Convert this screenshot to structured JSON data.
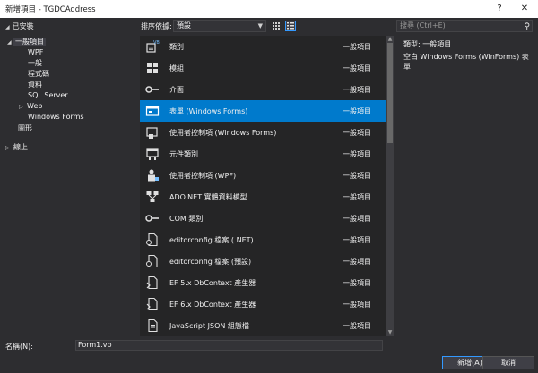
{
  "window": {
    "title": "新增項目 - TGDCAddress",
    "help_label": "?",
    "close_label": "✕"
  },
  "sidebar": {
    "header": "已安裝",
    "items": [
      {
        "label": "一般項目",
        "arrow": "◢",
        "selected": true
      },
      {
        "label": "WPF"
      },
      {
        "label": "一般"
      },
      {
        "label": "程式碼"
      },
      {
        "label": "資料"
      },
      {
        "label": "SQL Server"
      },
      {
        "label": "Web",
        "arrow": "▷"
      },
      {
        "label": "Windows Forms"
      },
      {
        "label": "圖形"
      }
    ],
    "online": {
      "label": "線上",
      "arrow": "▷"
    }
  },
  "toolbar": {
    "sort_label": "排序依據:",
    "sort_value": "預設",
    "search_placeholder": "搜尋 (Ctrl+E)"
  },
  "items": [
    {
      "name": "類別",
      "category": "一般項目",
      "icon": "class-icon"
    },
    {
      "name": "模組",
      "category": "一般項目",
      "icon": "module-icon"
    },
    {
      "name": "介面",
      "category": "一般項目",
      "icon": "interface-icon"
    },
    {
      "name": "表單 (Windows Forms)",
      "category": "一般項目",
      "icon": "form-icon",
      "selected": true
    },
    {
      "name": "使用者控制項 (Windows Forms)",
      "category": "一般項目",
      "icon": "user-control-icon"
    },
    {
      "name": "元件類別",
      "category": "一般項目",
      "icon": "component-icon"
    },
    {
      "name": "使用者控制項 (WPF)",
      "category": "一般項目",
      "icon": "wpf-control-icon"
    },
    {
      "name": "ADO.NET 實體資料模型",
      "category": "一般項目",
      "icon": "entity-model-icon"
    },
    {
      "name": "COM 類別",
      "category": "一般項目",
      "icon": "com-class-icon"
    },
    {
      "name": "editorconfig 檔案 (.NET)",
      "category": "一般項目",
      "icon": "file-icon"
    },
    {
      "name": "editorconfig 檔案 (預設)",
      "category": "一般項目",
      "icon": "file-icon"
    },
    {
      "name": "EF 5.x DbContext 產生器",
      "category": "一般項目",
      "icon": "ef-icon"
    },
    {
      "name": "EF 6.x DbContext 產生器",
      "category": "一般項目",
      "icon": "ef-icon"
    },
    {
      "name": "JavaScript JSON 組態檔",
      "category": "一般項目",
      "icon": "json-icon"
    }
  ],
  "details": {
    "type_label": "類型:",
    "type_value": "一般項目",
    "description": "空白 Windows Forms (WinForms) 表單"
  },
  "footer": {
    "name_label": "名稱(N):",
    "name_value": "Form1.vb",
    "add_label": "新增(A)",
    "cancel_label": "取消"
  }
}
